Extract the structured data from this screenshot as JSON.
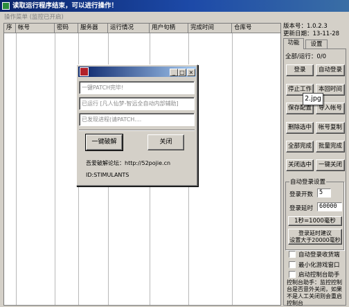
{
  "window": {
    "title": "读取运行程序结束，可以进行操作！"
  },
  "menu": {
    "item": "操作菜单 (监控已开启)"
  },
  "list": {
    "columns": [
      "序",
      "帐号",
      "密码",
      "服务器",
      "运行情况",
      "用户句柄",
      "完成时间",
      "仓库号"
    ]
  },
  "info": {
    "version": "版本号：1.0.2.3",
    "update_date": "更新日期：13-11-28"
  },
  "tabs": [
    "功能",
    "设置"
  ],
  "status": "全部/运行：0/0",
  "buttons": {
    "login": "登录",
    "auto_login": "自动登录",
    "stop_work": "停止工作",
    "switch_time": "本回时间",
    "save_config": "保存配置",
    "import_accounts": "导入帐号",
    "delete_selected": "删除选中",
    "copy_account": "帐号复制",
    "all_complete": "全部完成",
    "batch_complete": "批量完成",
    "close_selected": "关闭选中",
    "close_all": "一键关闭"
  },
  "auto_login": {
    "group_title": "自动登录设置",
    "count_label": "登录开数",
    "count_value": "5",
    "delay_label": "登录延时",
    "delay_value": "60000",
    "ms_button": "1秒=1000毫秒",
    "suggest_line1": "登录延时建议",
    "suggest_line2": "设置大于20000毫秒"
  },
  "checkboxes": [
    "自动登录收货端",
    "最小化游戏窗口",
    "启动控制台助手"
  ],
  "note": "控制台助手：监控控制台是否意外关闭，如果不是人工关闭则会重启控制台",
  "tooltip": "2.jpg",
  "dialog": {
    "field1": "一键PATCH完毕!",
    "field2": "已运行 [凡人仙梦-智远全自动内部辅助]",
    "field3": "已发现进程(请PATCH....",
    "crack_button": "一键破解",
    "close_button": "关闭",
    "forum": "吾爱破解论坛：http://52pojie.cn",
    "id": "ID:STIMULANTS"
  }
}
